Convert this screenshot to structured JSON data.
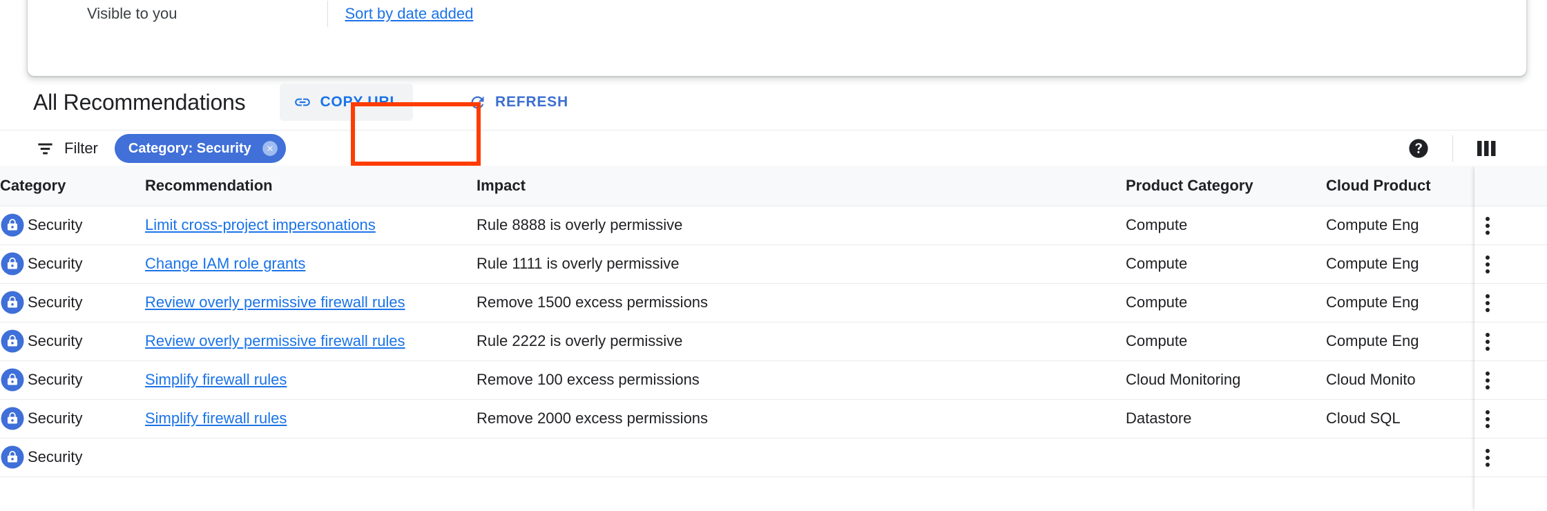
{
  "top_card": {
    "visibility_label": "Visible to you",
    "sort_link": "Sort by date added"
  },
  "section": {
    "title": "All Recommendations",
    "copy_url_label": "COPY URL",
    "refresh_label": "REFRESH",
    "copy_url_icon": "link-icon",
    "refresh_icon": "refresh-icon",
    "annotation_color": "#ff3c00"
  },
  "filter_bar": {
    "filter_icon": "filter-icon",
    "filter_label": "Filter",
    "chips": [
      {
        "label": "Category: Security",
        "remove_icon": "close-circle-icon"
      }
    ],
    "help_icon": "help-icon",
    "columns_icon": "columns-icon",
    "chip_color": "#4070d8"
  },
  "table": {
    "columns": [
      "Category",
      "Recommendation",
      "Impact",
      "Product Category",
      "Cloud Product"
    ],
    "row_icon": "lock-badge-icon",
    "row_menu_icon": "more-vert-icon",
    "rows": [
      {
        "category": "Security",
        "recommendation": "Limit cross-project impersonations",
        "impact": "Rule 8888 is overly permissive",
        "product_category": "Compute",
        "cloud_product": "Compute Eng"
      },
      {
        "category": "Security",
        "recommendation": "Change IAM role grants",
        "impact": "Rule 1111 is overly permissive",
        "product_category": "Compute",
        "cloud_product": "Compute Eng"
      },
      {
        "category": "Security",
        "recommendation": "Review overly permissive firewall rules",
        "impact": "Remove 1500 excess permissions",
        "product_category": "Compute",
        "cloud_product": "Compute Eng"
      },
      {
        "category": "Security",
        "recommendation": "Review overly permissive firewall rules",
        "impact": "Rule 2222 is overly permissive",
        "product_category": "Compute",
        "cloud_product": "Compute Eng"
      },
      {
        "category": "Security",
        "recommendation": "Simplify firewall rules",
        "impact": "Remove 100 excess permissions",
        "product_category": "Cloud Monitoring",
        "cloud_product": "Cloud Monito"
      },
      {
        "category": "Security",
        "recommendation": "Simplify firewall rules",
        "impact": "Remove 2000 excess permissions",
        "product_category": "Datastore",
        "cloud_product": "Cloud SQL"
      },
      {
        "category": "Security",
        "recommendation": "",
        "impact": "",
        "product_category": "",
        "cloud_product": ""
      }
    ]
  }
}
